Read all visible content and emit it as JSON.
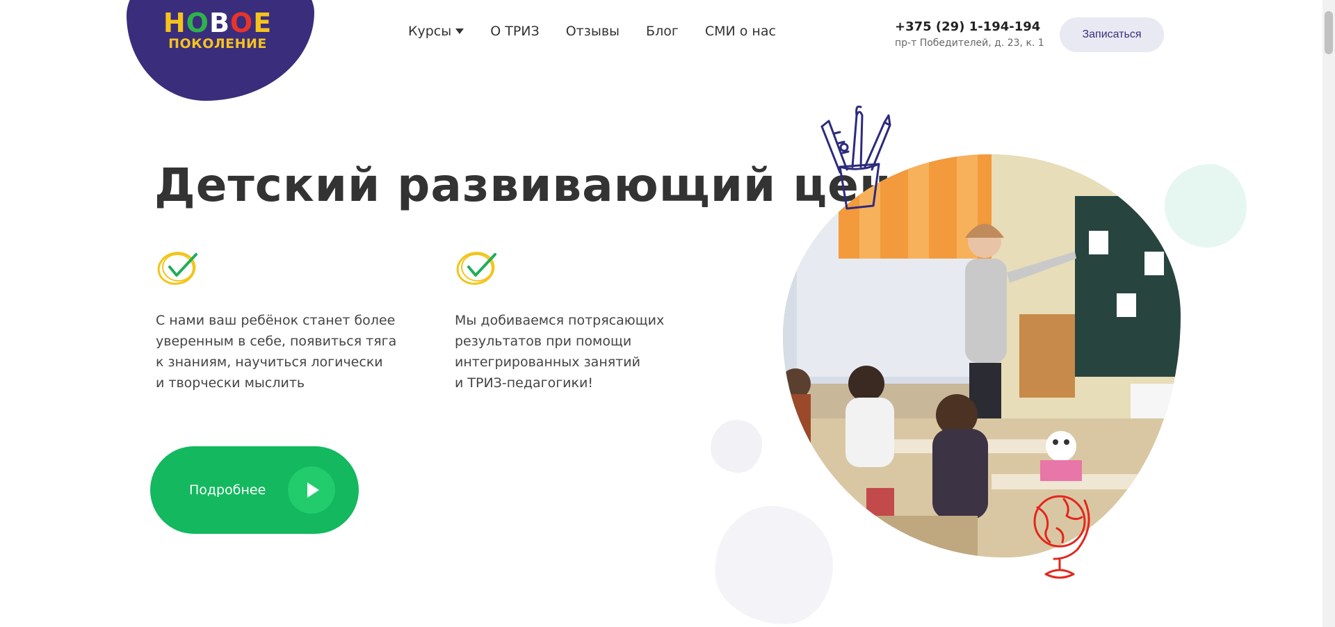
{
  "logo": {
    "line1_letters": [
      "Н",
      "О",
      "В",
      "О",
      "Е"
    ],
    "line2": "ПОКОЛЕНИЕ",
    "colors": [
      "#f6c31c",
      "#2fb24c",
      "#ffffff",
      "#e8342a",
      "#f6c31c"
    ]
  },
  "nav": {
    "items": [
      {
        "label": "Курсы",
        "dropdown": true
      },
      {
        "label": "О ТРИЗ"
      },
      {
        "label": "Отзывы"
      },
      {
        "label": "Блог"
      },
      {
        "label": "СМИ о нас"
      }
    ]
  },
  "contact": {
    "phone": "+375 (29) 1-194-194",
    "address": "пр-т Победителей, д. 23, к. 1"
  },
  "header": {
    "signup_label": "Записаться"
  },
  "hero": {
    "title": "Детский развивающий центр",
    "features": [
      {
        "icon": "checkmark-icon",
        "lines": [
          "С нами ваш ребёнок станет более",
          "уверенным в себе, появиться тяга",
          "к знаниям, научиться логически",
          "и творчески мыслить"
        ]
      },
      {
        "icon": "checkmark-icon",
        "lines": [
          "Мы добиваемся потрясающих",
          "результатов при помощи",
          "интегрированных занятий",
          "и ТРИЗ-педагогики!"
        ]
      }
    ],
    "more_label": "Подробнее"
  },
  "colors": {
    "brand_purple": "#3a2d7c",
    "accent_green": "#13b85f",
    "text": "#333333"
  }
}
